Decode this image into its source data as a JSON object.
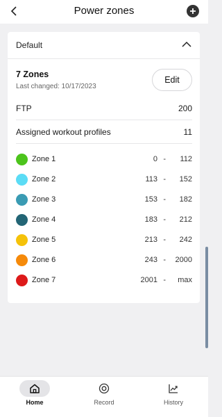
{
  "header": {
    "title": "Power zones",
    "back_icon": "chevron-left-icon",
    "add_icon": "plus-circle-icon"
  },
  "card": {
    "profile_label": "Default",
    "collapse_icon": "chevron-up-icon",
    "zones_title": "7 Zones",
    "last_changed": "Last changed: 10/17/2023",
    "edit_label": "Edit",
    "ftp_label": "FTP",
    "ftp_value": "200",
    "profiles_label": "Assigned workout profiles",
    "profiles_value": "11"
  },
  "zones": [
    {
      "name": "Zone 1",
      "min": "0",
      "dash": "-",
      "max": "112",
      "color": "#4cc41c"
    },
    {
      "name": "Zone 2",
      "min": "113",
      "dash": "-",
      "max": "152",
      "color": "#5bdcf5"
    },
    {
      "name": "Zone 3",
      "min": "153",
      "dash": "-",
      "max": "182",
      "color": "#3a9bb3"
    },
    {
      "name": "Zone 4",
      "min": "183",
      "dash": "-",
      "max": "212",
      "color": "#236575"
    },
    {
      "name": "Zone 5",
      "min": "213",
      "dash": "-",
      "max": "242",
      "color": "#f5c20a"
    },
    {
      "name": "Zone 6",
      "min": "243",
      "dash": "-",
      "max": "2000",
      "color": "#f58a0a"
    },
    {
      "name": "Zone 7",
      "min": "2001",
      "dash": "-",
      "max": "max",
      "color": "#dd1a1a"
    }
  ],
  "nav": [
    {
      "label": "Home",
      "icon": "home-icon",
      "active": true
    },
    {
      "label": "Record",
      "icon": "record-icon",
      "active": false
    },
    {
      "label": "History",
      "icon": "trend-chart-icon",
      "active": false
    }
  ]
}
